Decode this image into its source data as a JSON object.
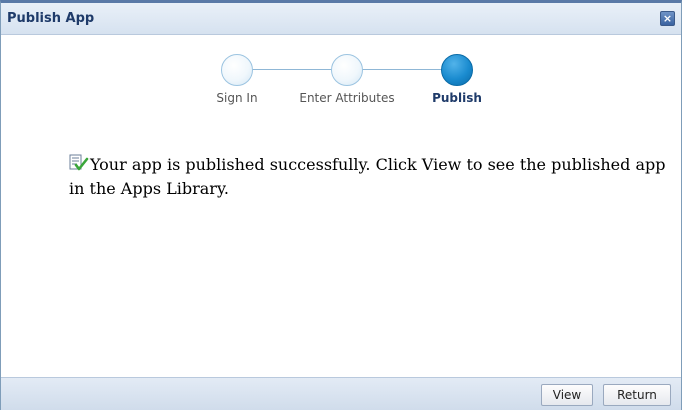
{
  "dialog": {
    "title": "Publish App",
    "close_icon": "close-icon"
  },
  "train": {
    "steps": [
      {
        "label": "Sign In",
        "state": "visited"
      },
      {
        "label": "Enter Attributes",
        "state": "visited"
      },
      {
        "label": "Publish",
        "state": "current"
      }
    ],
    "colors": {
      "current": "#1a8bcf",
      "visited": "#f0f7fc",
      "line": "#8fb7d6"
    }
  },
  "message": {
    "icon": "document-check-icon",
    "text": "Your app is published successfully. Click View to see the published app in the Apps Library."
  },
  "footer": {
    "view_label": "View",
    "return_label": "Return"
  }
}
